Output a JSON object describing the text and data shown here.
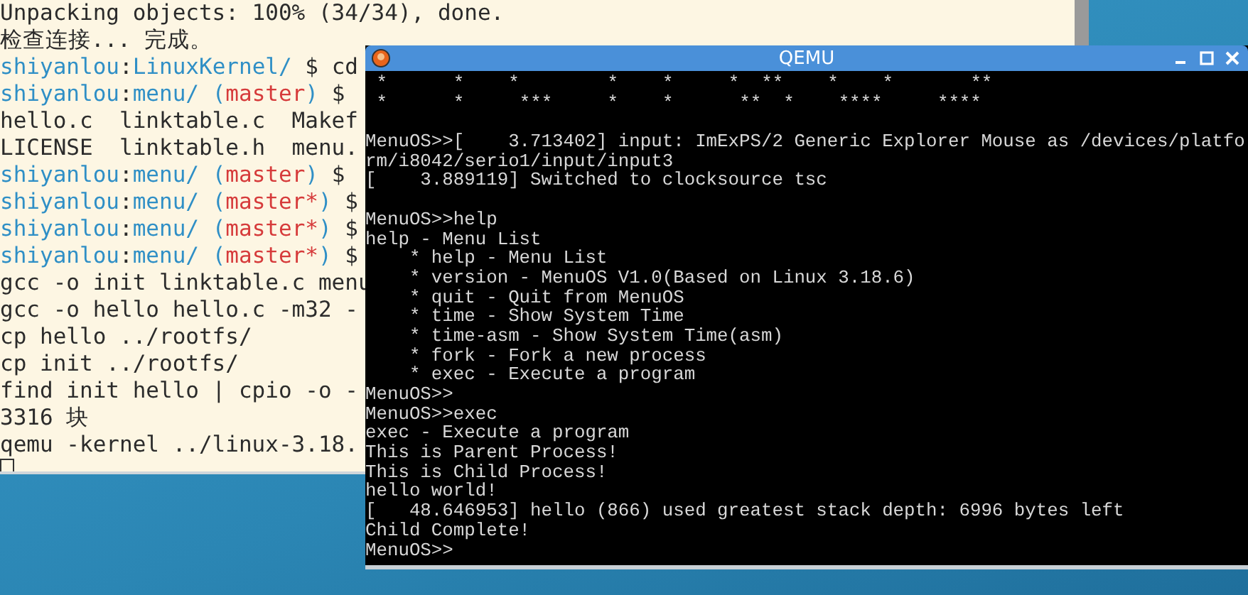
{
  "terminal": {
    "lines": [
      {
        "kind": "text",
        "text": "Unpacking objects: 100% (34/34), done."
      },
      {
        "kind": "text",
        "text": "检查连接... 完成。"
      },
      {
        "kind": "prompt",
        "parts": [
          {
            "kind": "user",
            "text": "shiyanlou"
          },
          {
            "kind": "plain",
            "text": ":"
          },
          {
            "kind": "path",
            "text": "LinuxKernel/"
          },
          {
            "kind": "plain",
            "text": " $ cd"
          }
        ]
      },
      {
        "kind": "prompt",
        "parts": [
          {
            "kind": "user",
            "text": "shiyanlou"
          },
          {
            "kind": "plain",
            "text": ":"
          },
          {
            "kind": "path",
            "text": "menu/ ("
          },
          {
            "kind": "branch",
            "text": "master"
          },
          {
            "kind": "path",
            "text": ")"
          },
          {
            "kind": "plain",
            "text": " $"
          }
        ]
      },
      {
        "kind": "text",
        "text": "hello.c  linktable.c  Makef"
      },
      {
        "kind": "text",
        "text": "LICENSE  linktable.h  menu."
      },
      {
        "kind": "prompt",
        "parts": [
          {
            "kind": "user",
            "text": "shiyanlou"
          },
          {
            "kind": "plain",
            "text": ":"
          },
          {
            "kind": "path",
            "text": "menu/ ("
          },
          {
            "kind": "branch",
            "text": "master"
          },
          {
            "kind": "path",
            "text": ")"
          },
          {
            "kind": "plain",
            "text": " $"
          }
        ]
      },
      {
        "kind": "prompt",
        "parts": [
          {
            "kind": "user",
            "text": "shiyanlou"
          },
          {
            "kind": "plain",
            "text": ":"
          },
          {
            "kind": "path",
            "text": "menu/ ("
          },
          {
            "kind": "branch",
            "text": "master*"
          },
          {
            "kind": "path",
            "text": ")"
          },
          {
            "kind": "plain",
            "text": " $"
          }
        ]
      },
      {
        "kind": "prompt",
        "parts": [
          {
            "kind": "user",
            "text": "shiyanlou"
          },
          {
            "kind": "plain",
            "text": ":"
          },
          {
            "kind": "path",
            "text": "menu/ ("
          },
          {
            "kind": "branch",
            "text": "master*"
          },
          {
            "kind": "path",
            "text": ")"
          },
          {
            "kind": "plain",
            "text": " $"
          }
        ]
      },
      {
        "kind": "prompt",
        "parts": [
          {
            "kind": "user",
            "text": "shiyanlou"
          },
          {
            "kind": "plain",
            "text": ":"
          },
          {
            "kind": "path",
            "text": "menu/ ("
          },
          {
            "kind": "branch",
            "text": "master*"
          },
          {
            "kind": "path",
            "text": ")"
          },
          {
            "kind": "plain",
            "text": " $"
          }
        ]
      },
      {
        "kind": "text",
        "text": "gcc -o init linktable.c menu"
      },
      {
        "kind": "text",
        "text": "gcc -o hello hello.c -m32 -"
      },
      {
        "kind": "text",
        "text": "cp hello ../rootfs/"
      },
      {
        "kind": "text",
        "text": "cp init ../rootfs/"
      },
      {
        "kind": "text",
        "text": "find init hello | cpio -o -"
      },
      {
        "kind": "text",
        "text": "3316 块"
      },
      {
        "kind": "text",
        "text": "qemu -kernel ../linux-3.18."
      },
      {
        "kind": "cursor"
      }
    ]
  },
  "qemu": {
    "title": "QEMU",
    "blocks": [
      {
        "kind": "art",
        "lines": [
          " *      *    *        *    *     *  **    *    *       **",
          " *      *     ***     *    *      **  *    ****     ****"
        ]
      },
      {
        "kind": "text",
        "lines": [
          "MenuOS>>[    3.713402] input: ImExPS/2 Generic Explorer Mouse as /devices/platfo",
          "rm/i8042/serio1/input/input3",
          "[    3.889119] Switched to clocksource tsc"
        ]
      },
      {
        "kind": "text",
        "lines": [
          "MenuOS>>help",
          "help - Menu List",
          "    * help - Menu List",
          "    * version - MenuOS V1.0(Based on Linux 3.18.6)",
          "    * quit - Quit from MenuOS",
          "    * time - Show System Time",
          "    * time-asm - Show System Time(asm)",
          "    * fork - Fork a new process",
          "    * exec - Execute a program",
          "MenuOS>>",
          "MenuOS>>exec",
          "exec - Execute a program",
          "This is Parent Process!",
          "This is Child Process!",
          "hello world!",
          "[   48.646953] hello (866) used greatest stack depth: 6996 bytes left",
          "Child Complete!",
          "MenuOS>>"
        ]
      }
    ]
  }
}
